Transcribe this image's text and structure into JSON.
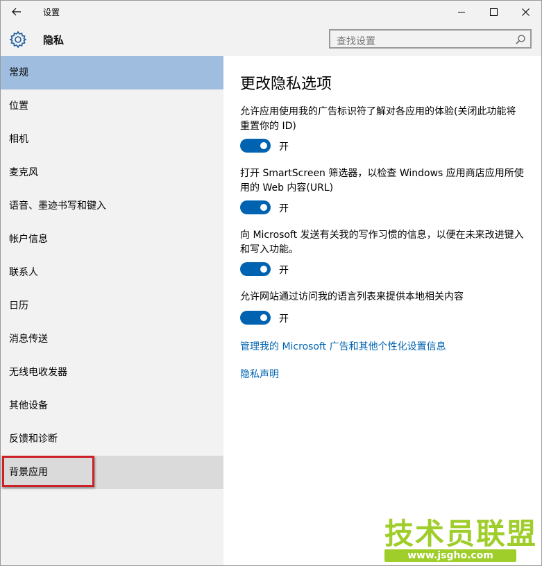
{
  "window": {
    "title": "设置"
  },
  "header": {
    "page_name": "隐私",
    "search_placeholder": "查找设置"
  },
  "sidebar": {
    "items": [
      {
        "label": "常规"
      },
      {
        "label": "位置"
      },
      {
        "label": "相机"
      },
      {
        "label": "麦克风"
      },
      {
        "label": "语音、墨迹书写和键入"
      },
      {
        "label": "帐户信息"
      },
      {
        "label": "联系人"
      },
      {
        "label": "日历"
      },
      {
        "label": "消息传送"
      },
      {
        "label": "无线电收发器"
      },
      {
        "label": "其他设备"
      },
      {
        "label": "反馈和诊断"
      },
      {
        "label": "背景应用"
      }
    ],
    "selected_index": 0,
    "hovered_index": 12
  },
  "main": {
    "title": "更改隐私选项",
    "settings": [
      {
        "description": "允许应用使用我的广告标识符了解对各应用的体验(关闭此功能将重置你的 ID)",
        "state": "开",
        "on": true
      },
      {
        "description": "打开 SmartScreen 筛选器，以检查 Windows 应用商店应用所使用的 Web 内容(URL)",
        "state": "开",
        "on": true
      },
      {
        "description": "向 Microsoft 发送有关我的写作习惯的信息，以便在未来改进键入和写入功能。",
        "state": "开",
        "on": true
      },
      {
        "description": "允许网站通过访问我的语言列表来提供本地相关内容",
        "state": "开",
        "on": true
      }
    ],
    "links": [
      {
        "label": "管理我的 Microsoft 广告和其他个性化设置信息"
      },
      {
        "label": "隐私声明"
      }
    ]
  },
  "watermark": {
    "text": "技术员联盟",
    "url": "www.jsgho.com",
    "suffix": "com"
  },
  "colors": {
    "accent": "#0063b1",
    "selected_nav": "#9ebddf",
    "annotation": "#cc1f28",
    "watermark_green": "#9fcd2a"
  }
}
